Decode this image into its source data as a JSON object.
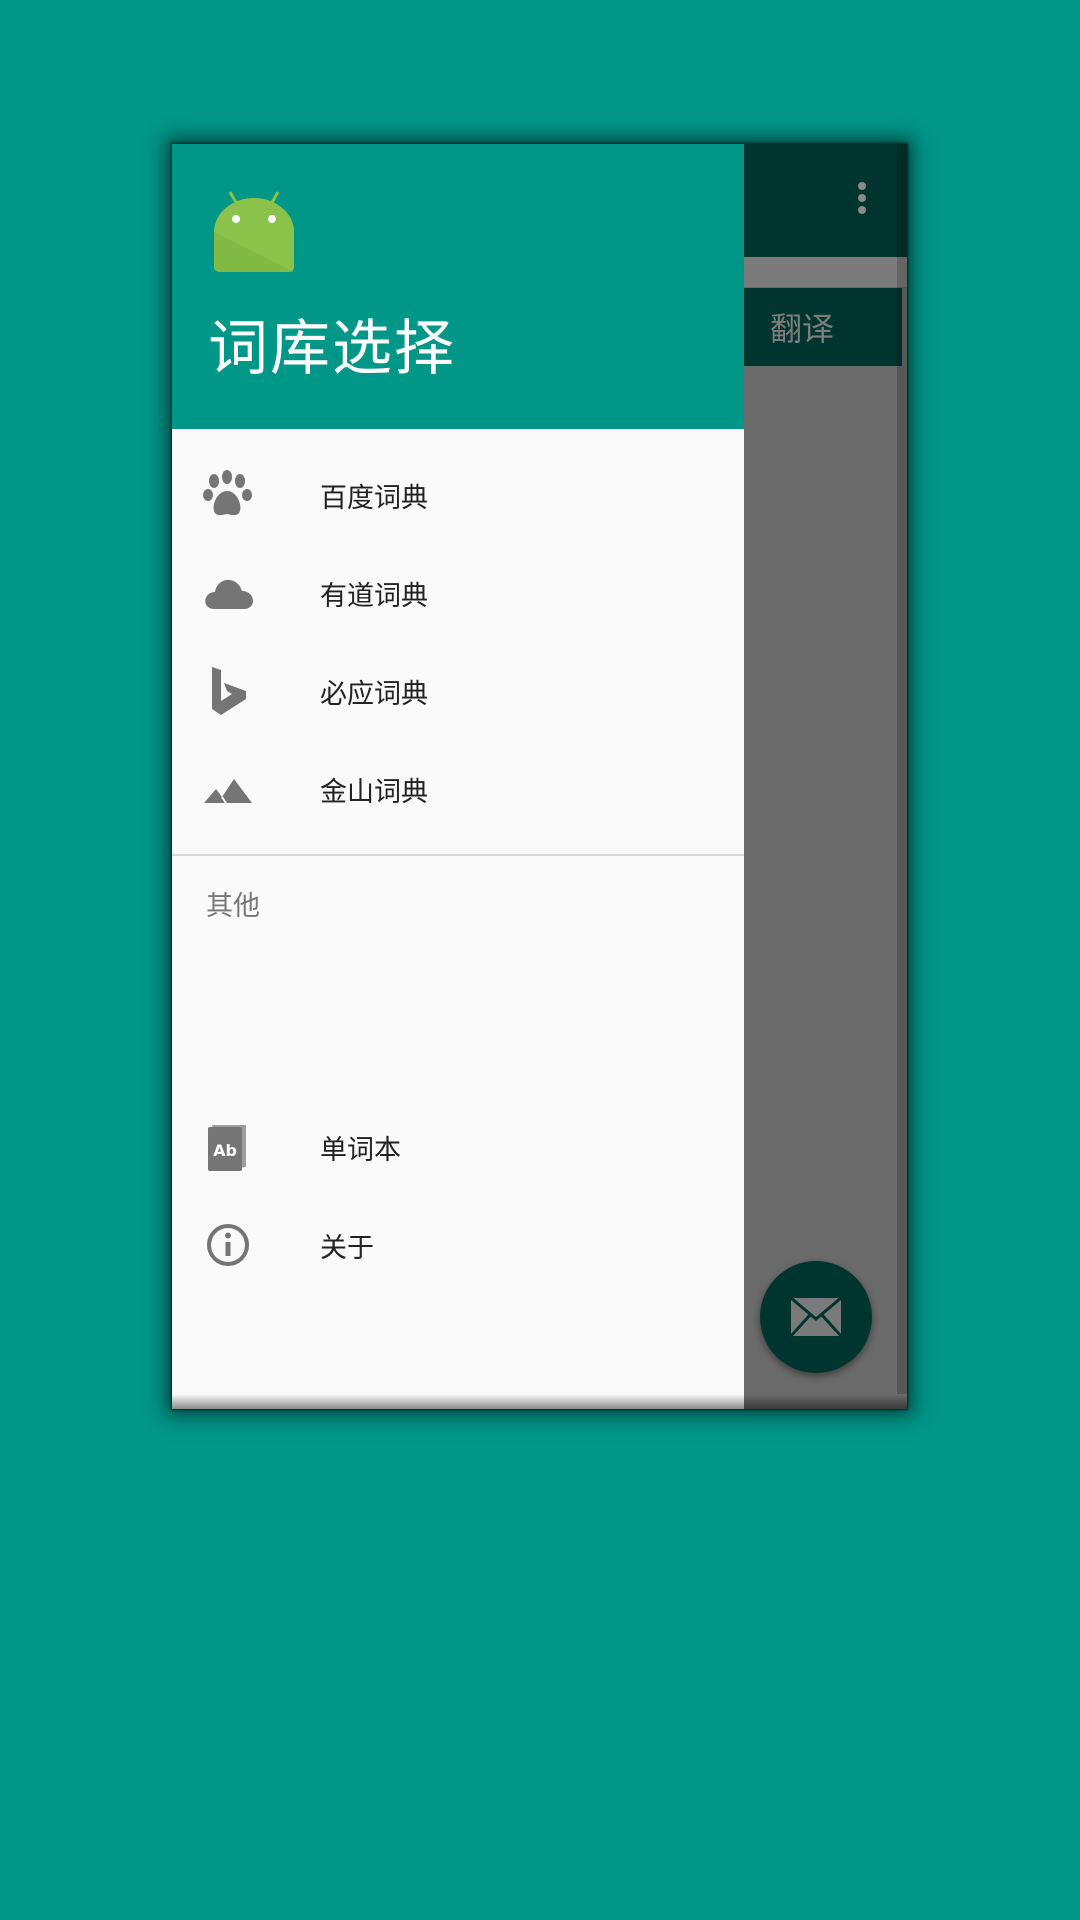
{
  "colors": {
    "primary": "#009688",
    "primary_dark_dimmed": "#00352f",
    "scrim": "#6b6b6b",
    "drawer_bg": "#fafafa",
    "icon_gray": "#757575",
    "android_green": "#8bc34a"
  },
  "app_bar": {
    "overflow_icon": "more-vert-icon",
    "translate_button_label": "翻译"
  },
  "fab": {
    "icon": "mail-icon"
  },
  "drawer": {
    "header": {
      "logo_icon": "android-logo-icon",
      "title": "词库选择"
    },
    "dictionaries": [
      {
        "label": "百度词典",
        "icon": "paw-icon"
      },
      {
        "label": "有道词典",
        "icon": "cloud-icon"
      },
      {
        "label": "必应词典",
        "icon": "bing-icon"
      },
      {
        "label": "金山词典",
        "icon": "landscape-icon"
      }
    ],
    "section_header": "其他",
    "other": [
      {
        "label": "单词本",
        "icon": "vocabulary-book-icon"
      },
      {
        "label": "关于",
        "icon": "info-icon"
      }
    ]
  }
}
